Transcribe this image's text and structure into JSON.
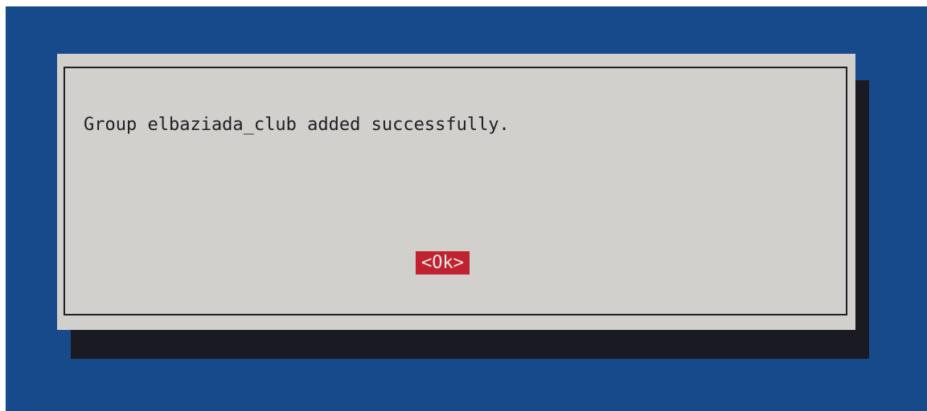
{
  "dialog": {
    "message": "Group elbaziada_club added successfully.",
    "ok_label": "<Ok>"
  },
  "colors": {
    "background": "#164a8b",
    "dialog": "#d1d0cc",
    "shadow": "#1a1a22",
    "button": "#c0232f"
  }
}
